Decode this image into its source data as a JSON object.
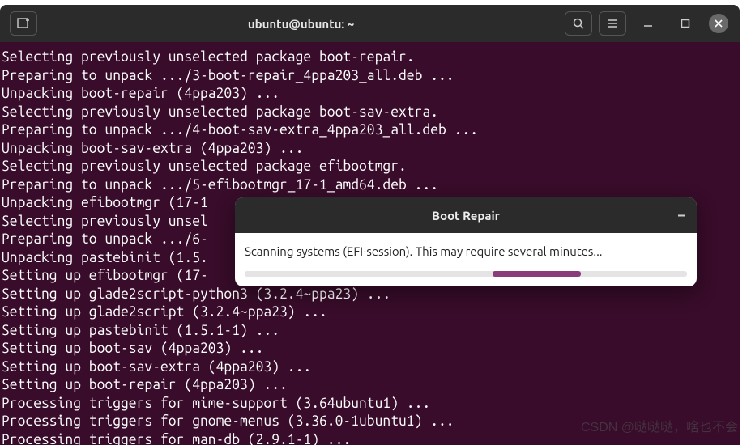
{
  "titlebar": {
    "title": "ubuntu@ubuntu: ~"
  },
  "terminal": {
    "lines": [
      "Selecting previously unselected package boot-repair.",
      "Preparing to unpack .../3-boot-repair_4ppa203_all.deb ...",
      "Unpacking boot-repair (4ppa203) ...",
      "Selecting previously unselected package boot-sav-extra.",
      "Preparing to unpack .../4-boot-sav-extra_4ppa203_all.deb ...",
      "Unpacking boot-sav-extra (4ppa203) ...",
      "Selecting previously unselected package efibootmgr.",
      "Preparing to unpack .../5-efibootmgr_17-1_amd64.deb ...",
      "Unpacking efibootmgr (17-1",
      "Selecting previously unsel",
      "Preparing to unpack .../6-",
      "Unpacking pastebinit (1.5.",
      "Setting up efibootmgr (17-",
      "Setting up glade2script-python3 (3.2.4~ppa23) ...",
      "Setting up glade2script (3.2.4~ppa23) ...",
      "Setting up pastebinit (1.5.1-1) ...",
      "Setting up boot-sav (4ppa203) ...",
      "Setting up boot-sav-extra (4ppa203) ...",
      "Setting up boot-repair (4ppa203) ...",
      "Processing triggers for mime-support (3.64ubuntu1) ...",
      "Processing triggers for gnome-menus (3.36.0-1ubuntu1) ...",
      "Processing triggers for man-db (2.9.1-1) ..."
    ]
  },
  "dialog": {
    "title": "Boot Repair",
    "message": "Scanning systems (EFI-session). This may require several minutes..."
  },
  "watermark": "CSDN @哒哒哒，啥也不会"
}
